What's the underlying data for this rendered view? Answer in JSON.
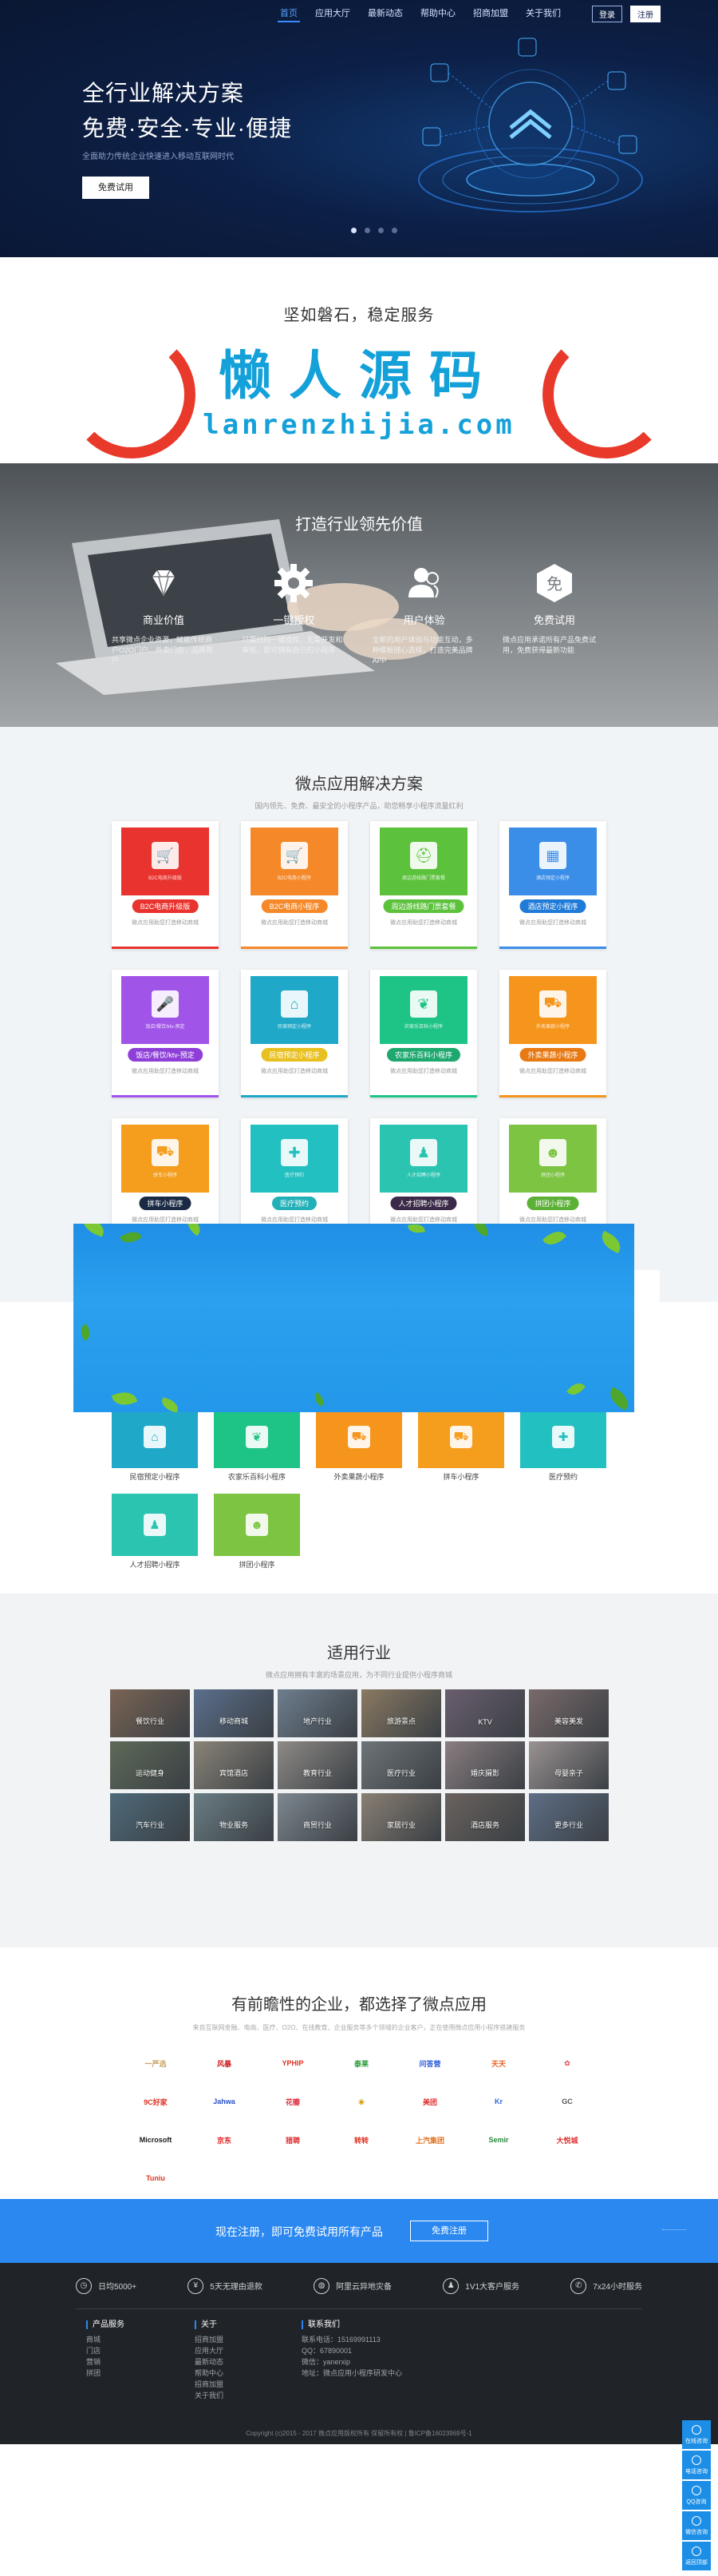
{
  "nav": {
    "items": [
      "首页",
      "应用大厅",
      "最新动态",
      "帮助中心",
      "招商加盟",
      "关于我们"
    ],
    "login": "登录",
    "register": "注册"
  },
  "hero": {
    "title_line1": "全行业解决方案",
    "title_line2": "免费·安全·专业·便捷",
    "subtitle": "全面助力传统企业快速进入移动互联网时代",
    "cta": "免费试用"
  },
  "stable": {
    "title": "坚如磐石，稳定服务",
    "watermark_cn": "懒人源码",
    "watermark_en": "lanrenzhijia.com"
  },
  "value": {
    "title": "打造行业领先价值",
    "items": [
      {
        "name": "商业价值",
        "icon": "diamond-icon",
        "desc": "共享微点企业资源，赋能传统商户O2O门户、外卖门店，品牌商户"
      },
      {
        "name": "一键授权",
        "icon": "gear-icon",
        "desc": "只需扫码一键授权，无需开发和审核，即可拥有自己的小程序"
      },
      {
        "name": "用户体验",
        "icon": "users-icon",
        "desc": "全新的用户体验与功能互动，多种模板随心选择，打造完美品牌APP"
      },
      {
        "name": "免费试用",
        "icon": "free-icon",
        "desc": "微点应用承诺所有产品免费试用，免费获得最新功能"
      }
    ]
  },
  "solutions": {
    "title": "微点应用解决方案",
    "subtitle": "国内领先、免费、最安全的小程序产品，助您畅享小程序流量红利",
    "card_desc": "微点应用助您打造移动商城",
    "cards": [
      {
        "name": "B2C电商升级版",
        "color": "#e8332e",
        "tag": "#e8332e",
        "icon": "cart-icon"
      },
      {
        "name": "B2C电商小程序",
        "color": "#f5892a",
        "tag": "#f5892a",
        "icon": "cart-icon"
      },
      {
        "name": "周边游线路门票套餐",
        "color": "#5cc23c",
        "tag": "#5cc23c",
        "icon": "hat-icon"
      },
      {
        "name": "酒店预定小程序",
        "color": "#3b8ee8",
        "tag": "#1f7ad8",
        "icon": "hotel-icon"
      },
      {
        "name": "饭店/餐饮/ktv-预定",
        "color": "#a154e8",
        "tag": "#8e3fd8",
        "icon": "mic-icon"
      },
      {
        "name": "民宿预定小程序",
        "color": "#20a8c8",
        "tag": "#e8c020",
        "icon": "house-icon"
      },
      {
        "name": "农家乐百科小程序",
        "color": "#1ec486",
        "tag": "#1ea86e",
        "icon": "leaf-icon"
      },
      {
        "name": "外卖果蔬小程序",
        "color": "#f5951c",
        "tag": "#e87a14",
        "icon": "truck-icon"
      },
      {
        "name": "拼车小程序",
        "color": "#f59d1c",
        "tag": "#1b2a44",
        "icon": "car-icon"
      },
      {
        "name": "医疗预约",
        "color": "#22c0c0",
        "tag": "#22b0b8",
        "icon": "hospital-icon"
      },
      {
        "name": "人才招聘小程序",
        "color": "#2ac4b0",
        "tag": "#3a2a48",
        "icon": "person-icon"
      },
      {
        "name": "拼团小程序",
        "color": "#7cc442",
        "tag": "#5bb036",
        "icon": "group-icon"
      }
    ]
  },
  "grid2": {
    "items": [
      {
        "name": "B2C电商升级版",
        "color": "#e8332e"
      },
      {
        "name": "B2C电商小程序",
        "color": "#f5892a"
      },
      {
        "name": "周边游线路门票套餐",
        "color": "#5cc23c"
      },
      {
        "name": "酒店预定小程序",
        "color": "#3b8ee8"
      },
      {
        "name": "饭店/餐饮/ktv-预定",
        "color": "#a154e8"
      },
      {
        "name": "民宿预定小程序",
        "color": "#20a8c8"
      },
      {
        "name": "农家乐百科小程序",
        "color": "#1ec486"
      },
      {
        "name": "外卖果蔬小程序",
        "color": "#f5951c"
      },
      {
        "name": "拼车小程序",
        "color": "#f59d1c"
      },
      {
        "name": "医疗预约",
        "color": "#22c0c0"
      },
      {
        "name": "人才招聘小程序",
        "color": "#2ac4b0"
      },
      {
        "name": "拼团小程序",
        "color": "#7cc442"
      }
    ]
  },
  "industries": {
    "title": "适用行业",
    "subtitle": "微点应用拥有丰富的场景应用，为不同行业提供小程序商城",
    "items": [
      {
        "label": "餐饮行业",
        "color": "#7a6454"
      },
      {
        "label": "移动商城",
        "color": "#5b6f8c"
      },
      {
        "label": "地产行业",
        "color": "#6e7e8e"
      },
      {
        "label": "旅游景点",
        "color": "#8a7a62"
      },
      {
        "label": "KTV",
        "color": "#6a5e6e"
      },
      {
        "label": "美容美发",
        "color": "#7a6a6a"
      },
      {
        "label": "运动健身",
        "color": "#5e6a58"
      },
      {
        "label": "宾馆酒店",
        "color": "#8a8478"
      },
      {
        "label": "教育行业",
        "color": "#8e8a86"
      },
      {
        "label": "医疗行业",
        "color": "#6e7478"
      },
      {
        "label": "婚庆摄影",
        "color": "#8a7e80"
      },
      {
        "label": "母婴亲子",
        "color": "#9a9292"
      },
      {
        "label": "汽车行业",
        "color": "#4e6a7a"
      },
      {
        "label": "物业服务",
        "color": "#6a7e84"
      },
      {
        "label": "商贸行业",
        "color": "#7e8890"
      },
      {
        "label": "家居行业",
        "color": "#8a8074"
      },
      {
        "label": "酒店服务",
        "color": "#6a625e"
      },
      {
        "label": "更多行业",
        "color": "#5e6e86"
      }
    ]
  },
  "clients": {
    "title": "有前瞻性的企业，都选择了微点应用",
    "subtitle": "来自互联网金融、电商、医疗、O2O、在线教育、企业服务等多个领域的企业客户，正在使用微点应用小程序搭建服务",
    "logos": [
      {
        "text": "一严选",
        "color": "#c8a060"
      },
      {
        "text": "风暴",
        "color": "#d02020"
      },
      {
        "text": "YPHIP",
        "color": "#e03020"
      },
      {
        "text": "泰莱",
        "color": "#2a9a3a"
      },
      {
        "text": "问答营",
        "color": "#2a5ad8"
      },
      {
        "text": "天天",
        "color": "#e86020"
      },
      {
        "text": "✿",
        "color": "#e04050"
      },
      {
        "text": "9C好家",
        "color": "#e03020"
      },
      {
        "text": "Jahwa",
        "color": "#2a50c8"
      },
      {
        "text": "花瓣",
        "color": "#e03040"
      },
      {
        "text": "◉",
        "color": "#d8a010"
      },
      {
        "text": "美团",
        "color": "#e03030"
      },
      {
        "text": "Kr",
        "color": "#2a6ae0"
      },
      {
        "text": "GC",
        "color": "#555555"
      },
      {
        "text": "Microsoft",
        "color": "#1a1a1a"
      },
      {
        "text": "京东",
        "color": "#e02020"
      },
      {
        "text": "猎聘",
        "color": "#e03030"
      },
      {
        "text": "转转",
        "color": "#e03020"
      },
      {
        "text": "上汽集团",
        "color": "#e07020"
      },
      {
        "text": "Semir",
        "color": "#2a8a3a"
      },
      {
        "text": "大悦城",
        "color": "#e03030"
      },
      {
        "text": "Tuniu",
        "color": "#e03020"
      }
    ]
  },
  "cta": {
    "text": "现在注册，即可免费试用所有产品",
    "button": "免费注册"
  },
  "footer": {
    "features": [
      {
        "icon": "clock-icon",
        "label": "日均5000+",
        "glyph": "◷"
      },
      {
        "icon": "shield-icon",
        "label": "5天无理由退款",
        "glyph": "¥"
      },
      {
        "icon": "globe-icon",
        "label": "阿里云异地灾备",
        "glyph": "◍"
      },
      {
        "icon": "service-icon",
        "label": "1V1大客户服务",
        "glyph": "♟"
      },
      {
        "icon": "phone-icon",
        "label": "7x24小时服务",
        "glyph": "✆"
      }
    ],
    "col_products": {
      "title": "产品服务",
      "items": [
        "商城",
        "门店",
        "营销",
        "拼团"
      ]
    },
    "col_about": {
      "title": "关于",
      "items": [
        "招商加盟",
        "应用大厅",
        "最新动态",
        "帮助中心",
        "招商加盟",
        "关于我们"
      ]
    },
    "col_contact": {
      "title": "联系我们",
      "items": [
        "联系电话：15169991113",
        "QQ：67890001",
        "微信：yanerxip",
        "地址：微点应用小程序研发中心"
      ]
    },
    "copyright": "Copyright (c)2015 - 2017 微点应用版权所有 保留所有权 | 鲁ICP备16023969号-1"
  },
  "side": {
    "items": [
      "在线咨询",
      "电话咨询",
      "QQ咨询",
      "微信咨询",
      "返回顶部"
    ]
  },
  "colors": {
    "accent": "#2a88f0",
    "hero_bg": "#0c1f45",
    "footer_bg": "#202428"
  }
}
